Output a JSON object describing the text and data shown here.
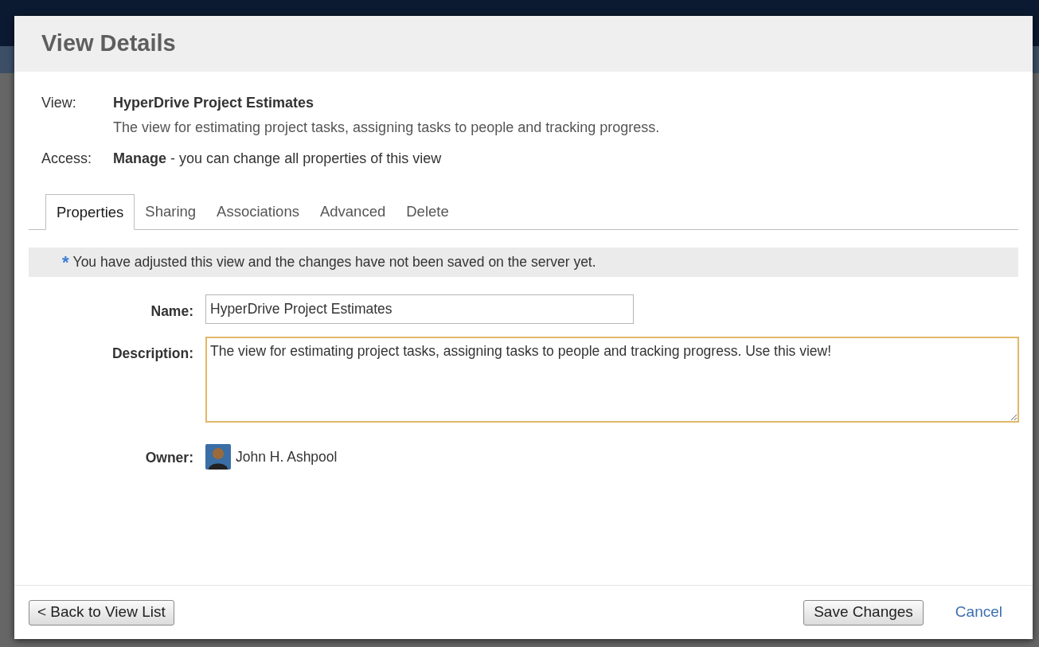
{
  "dialog": {
    "title": "View Details"
  },
  "info": [
    {
      "label": "View:",
      "value": "HyperDrive Project Estimates",
      "detail": "The view for estimating project tasks, assigning tasks to people and tracking progress."
    },
    {
      "label": "Access:",
      "value": "**Manage** - you can change all properties of this view"
    }
  ],
  "tabs": [
    {
      "label": "Properties",
      "selected": true
    },
    {
      "label": "Sharing",
      "selected": false
    },
    {
      "label": "Associations",
      "selected": false
    },
    {
      "label": "Advanced",
      "selected": false
    },
    {
      "label": "Delete",
      "selected": false
    }
  ],
  "notice": {
    "mark": "*",
    "text": "You have adjusted this view and the changes have not been saved on the server yet."
  },
  "form": {
    "name": {
      "label": "Name:",
      "value": "HyperDrive Project Estimates"
    },
    "description": {
      "label": "Description:",
      "value": "The view for estimating project tasks, assigning tasks to people and tracking progress. Use this view!",
      "focused": true
    },
    "owner": {
      "label": "Owner:",
      "value": "John H. Ashpool"
    }
  },
  "footer": {
    "back_button": "< Back to View List",
    "save_button": "Save Changes",
    "cancel_link": "Cancel"
  }
}
